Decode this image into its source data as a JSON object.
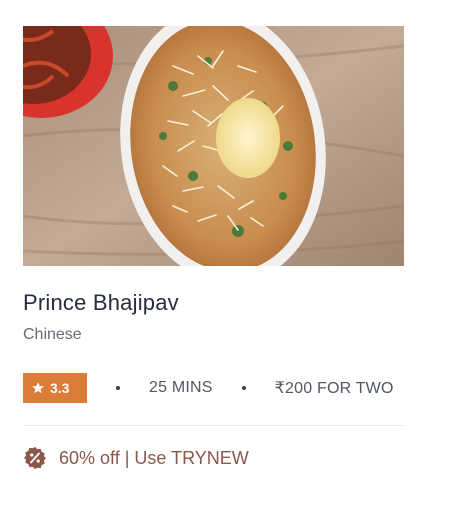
{
  "restaurant": {
    "name": "Prince Bhajipav",
    "cuisine": "Chinese",
    "photo_alt": "star-icon"
  },
  "meta": {
    "rating": "3.3",
    "delivery_time": "25 MINS",
    "cost_for_two": "₹200 FOR TWO"
  },
  "offer": {
    "text": "60% off | Use TRYNEW"
  },
  "colors": {
    "rating_badge": "#db7c38",
    "offer_text": "#8a584b"
  }
}
